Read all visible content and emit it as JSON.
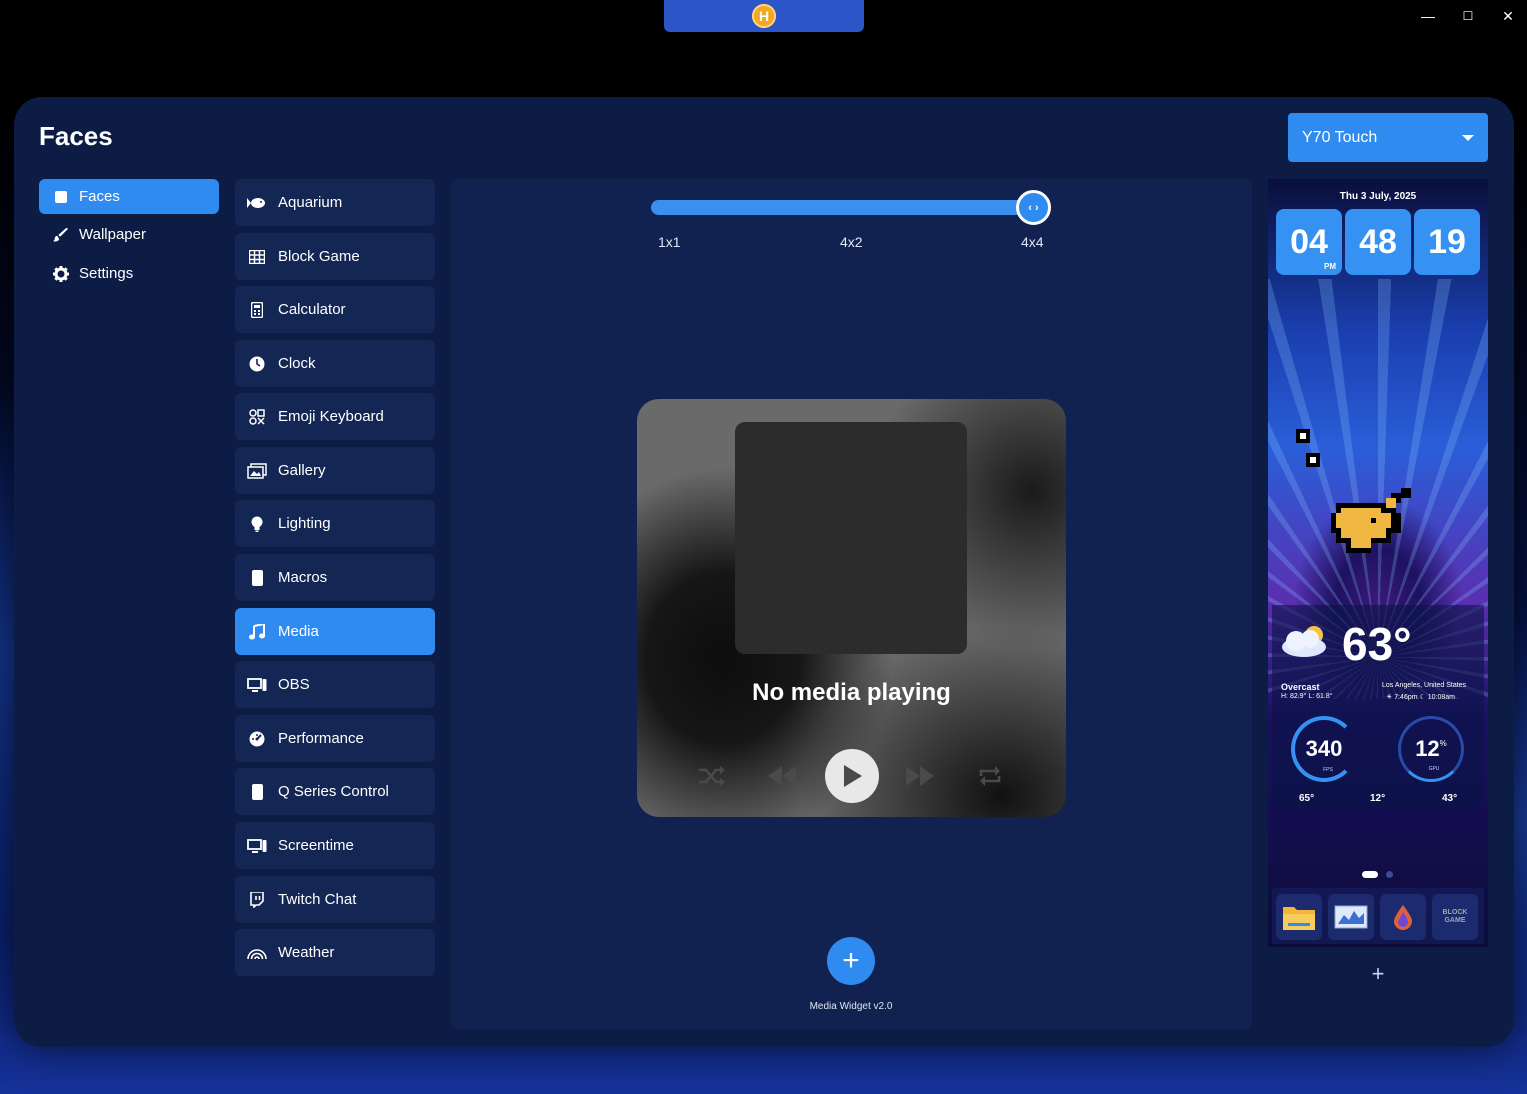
{
  "window": {
    "logo_letter": "H",
    "minimize": "—",
    "maximize": "☐",
    "close": "✕"
  },
  "page": {
    "title": "Faces"
  },
  "nav": {
    "items": [
      {
        "label": "Faces",
        "icon": "square-icon",
        "active": true
      },
      {
        "label": "Wallpaper",
        "icon": "brush-icon",
        "active": false
      },
      {
        "label": "Settings",
        "icon": "gear-icon",
        "active": false
      }
    ]
  },
  "faces": {
    "items": [
      {
        "label": "Aquarium",
        "icon": "fish-icon"
      },
      {
        "label": "Block Game",
        "icon": "grid-icon"
      },
      {
        "label": "Calculator",
        "icon": "calculator-icon"
      },
      {
        "label": "Clock",
        "icon": "clock-icon"
      },
      {
        "label": "Emoji Keyboard",
        "icon": "emoji-icon"
      },
      {
        "label": "Gallery",
        "icon": "gallery-icon"
      },
      {
        "label": "Lighting",
        "icon": "bulb-icon"
      },
      {
        "label": "Macros",
        "icon": "phone-icon"
      },
      {
        "label": "Media",
        "icon": "music-icon",
        "active": true
      },
      {
        "label": "OBS",
        "icon": "screen-icon"
      },
      {
        "label": "Performance",
        "icon": "gauge-icon"
      },
      {
        "label": "Q Series Control",
        "icon": "phone-icon"
      },
      {
        "label": "Screentime",
        "icon": "screen-icon"
      },
      {
        "label": "Twitch Chat",
        "icon": "twitch-icon"
      },
      {
        "label": "Weather",
        "icon": "rainbow-icon"
      }
    ]
  },
  "size_slider": {
    "labels": [
      "1x1",
      "4x2",
      "4x4"
    ],
    "selected": "4x4",
    "thumb_glyph": "‹ ›"
  },
  "media": {
    "status": "No media playing"
  },
  "widget": {
    "version_label": "Media Widget v2.0",
    "add_glyph": "+"
  },
  "device": {
    "selected": "Y70 Touch"
  },
  "preview": {
    "date": "Thu 3 July, 2025",
    "hour": "04",
    "minute": "48",
    "second": "19",
    "ampm": "PM",
    "temperature": "63°",
    "condition": "Overcast",
    "hi_lo": "H: 82.9° L: 61.8°",
    "location": "Los Angeles, United States",
    "sun_times": "☀ 7:46pm  ☾ 10:08am",
    "fps_value": "340",
    "fps_label": "FPS",
    "gpu_value": "12",
    "gpu_unit": "%",
    "gpu_label": "GPU",
    "stat_left": "65°",
    "stat_mid": "12°",
    "stat_right": "43°",
    "dock_block_label_1": "BLOCK",
    "dock_block_label_2": "GAME",
    "add_glyph": "+"
  },
  "colors": {
    "accent": "#2f8bf0",
    "panel": "#0c1c45",
    "item_bg": "#142654"
  }
}
